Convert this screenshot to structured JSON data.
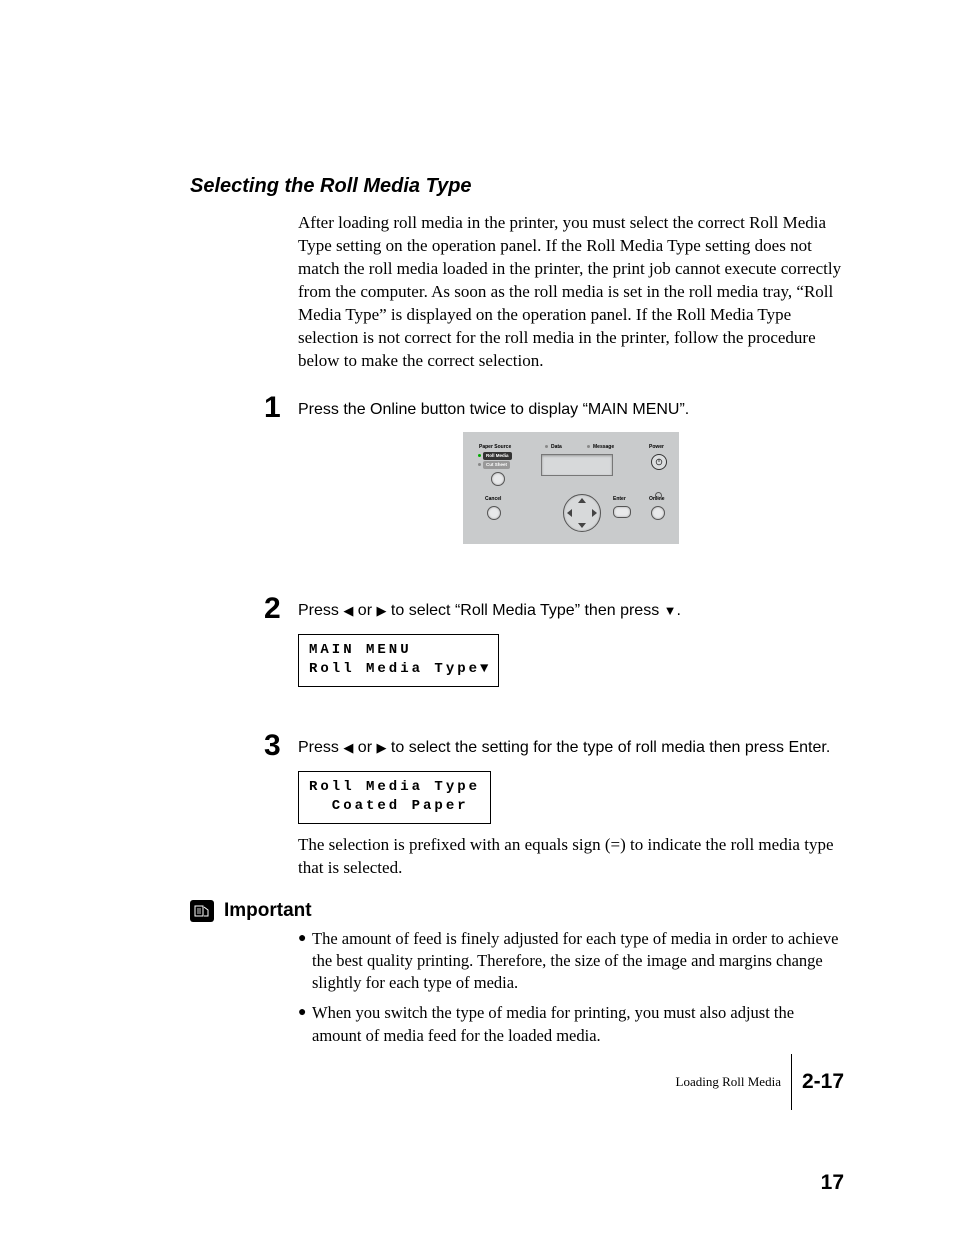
{
  "heading": "Selecting the Roll Media Type",
  "intro": "After loading roll media in the printer, you must select the correct Roll Media Type setting on the operation panel. If the Roll Media Type setting does not match the roll media loaded in the printer, the print job cannot execute correctly from the computer. As soon as the roll media is set in the roll media tray, “Roll Media Type” is displayed on the operation panel. If the Roll Media Type selection is not correct for the roll media in the printer, follow the procedure below to make the correct selection.",
  "steps": {
    "s1": {
      "num": "1",
      "text": "Press the Online button twice to display “MAIN MENU”."
    },
    "s2": {
      "num": "2",
      "prefix": "Press ",
      "mid1": " or ",
      "mid2": " to select “Roll Media Type” then press ",
      "suffix": ".",
      "lcd_line1": "MAIN MENU",
      "lcd_line2": "Roll Media Type"
    },
    "s3": {
      "num": "3",
      "prefix": "Press ",
      "mid1": " or ",
      "mid2": " to select the setting for the type of roll media then press Enter.",
      "lcd_line1": "Roll Media Type",
      "lcd_line2": "  Coated Paper",
      "after": "The selection is prefixed with an equals sign (=) to indicate the roll media type that is selected."
    }
  },
  "important": {
    "label": "Important",
    "bullets": [
      "The amount of feed is finely adjusted for each type of media in order to achieve the best quality printing. Therefore, the size of the image and margins change slightly for each type of media.",
      "When you switch the type of media for printing, you must also adjust the amount of media feed for the loaded media."
    ]
  },
  "panel": {
    "paper_source": "Paper Source",
    "roll_media": "Roll Media",
    "cut_sheet": "Cut Sheet",
    "data": "Data",
    "message": "Message",
    "power": "Power",
    "cancel": "Cancel",
    "enter": "Enter",
    "online": "Online"
  },
  "glyphs": {
    "left": "◀",
    "right": "▶",
    "down": "▼"
  },
  "footer": {
    "title": "Loading Roll Media",
    "page_label": "2-17",
    "bottom_page": "17"
  }
}
